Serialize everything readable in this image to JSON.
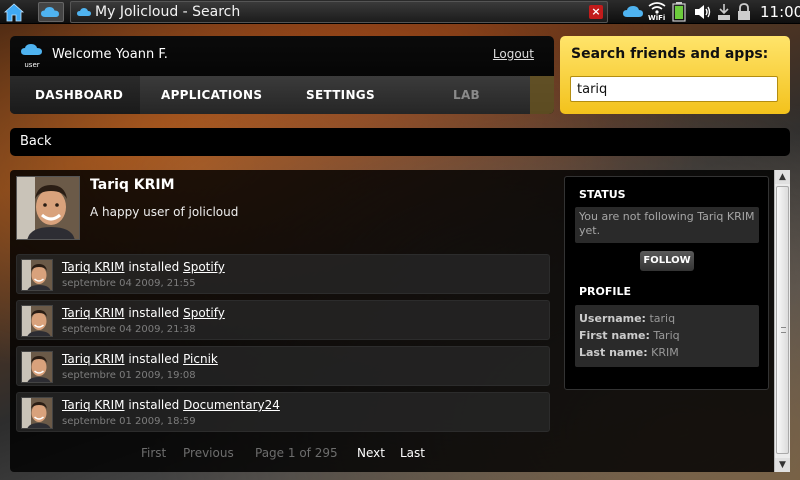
{
  "top_panel": {
    "window_title": "My Jolicloud - Search",
    "close_glyph": "×",
    "wifi_label": "WiFi",
    "clock": "11:00",
    "icons": [
      "home-icon",
      "cloud-icon",
      "wifi-icon",
      "battery-icon",
      "volume-icon",
      "network-icon",
      "lock-icon",
      "power-icon"
    ]
  },
  "header": {
    "user_icon_label": "user",
    "welcome": "Welcome Yoann F.",
    "logout": "Logout",
    "nav": [
      {
        "label": "DASHBOARD",
        "state": "active"
      },
      {
        "label": "APPLICATIONS",
        "state": "normal"
      },
      {
        "label": "SETTINGS",
        "state": "normal"
      },
      {
        "label": "LAB",
        "state": "disabled"
      }
    ]
  },
  "search": {
    "label": "Search friends and apps:",
    "value": "tariq",
    "accent": "#f5cb2a"
  },
  "back": {
    "label": "Back"
  },
  "profile": {
    "name": "Tariq KRIM",
    "tagline": "A happy user of jolicloud"
  },
  "activity": [
    {
      "user": "Tariq KRIM",
      "verb": "installed",
      "app": "Spotify",
      "date": "septembre 04 2009, 21:55"
    },
    {
      "user": "Tariq KRIM",
      "verb": "installed",
      "app": "Spotify",
      "date": "septembre 04 2009, 21:38"
    },
    {
      "user": "Tariq KRIM",
      "verb": "installed",
      "app": "Picnik",
      "date": "septembre 01 2009, 19:08"
    },
    {
      "user": "Tariq KRIM",
      "verb": "installed",
      "app": "Documentary24",
      "date": "septembre 01 2009, 18:59"
    }
  ],
  "pager": {
    "first": "First",
    "previous": "Previous",
    "page_info": "Page 1 of 295",
    "next": "Next",
    "last": "Last"
  },
  "sidebar": {
    "status_heading": "STATUS",
    "status_text": "You are not following Tariq KRIM yet.",
    "follow": "FOLLOW",
    "profile_heading": "PROFILE",
    "fields": [
      {
        "key": "Username:",
        "value": "tariq"
      },
      {
        "key": "First name:",
        "value": "Tariq"
      },
      {
        "key": "Last name:",
        "value": "KRIM"
      }
    ]
  }
}
